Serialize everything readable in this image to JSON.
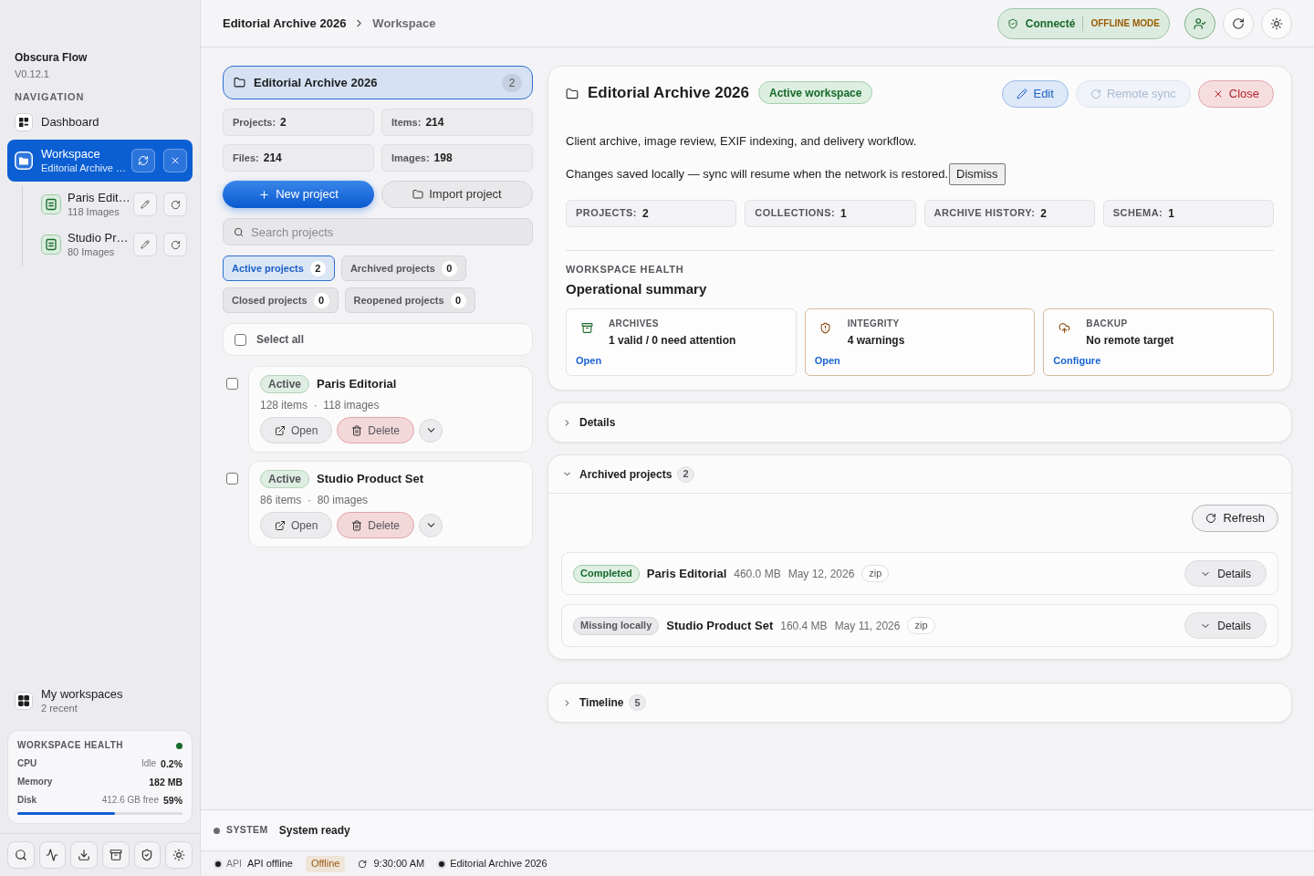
{
  "sidebar": {
    "app_name": "Obscura Flow",
    "version": "V0.12.1",
    "section_label": "NAVIGATION",
    "items": [
      {
        "kind": "link",
        "label": "Dashboard",
        "selected": false
      },
      {
        "kind": "workspace",
        "label": "Workspace",
        "sublabel": "Editorial Archive …",
        "selected": true,
        "children": [
          {
            "label": "Paris Edit…",
            "sublabel": "118 Images"
          },
          {
            "label": "Studio Pr…",
            "sublabel": "80 Images"
          }
        ]
      }
    ],
    "recent": {
      "label": "My workspaces",
      "sublabel": "2 recent"
    },
    "health": {
      "title": "WORKSPACE HEALTH",
      "healthy": true,
      "rows": [
        {
          "label": "CPU",
          "note": "Idle",
          "value": "0.2%"
        },
        {
          "label": "Memory",
          "value": "182 MB"
        },
        {
          "label": "Disk",
          "note": "412.6 GB free",
          "value": "59%",
          "level": 0.59
        }
      ]
    },
    "footer_buttons": [
      {
        "kind": "search"
      },
      {
        "kind": "activity"
      },
      {
        "kind": "download"
      },
      {
        "kind": "archive"
      },
      {
        "kind": "shield"
      },
      {
        "kind": "settings"
      }
    ]
  },
  "top_bar": {
    "breadcrumb": [
      "Editorial Archive 2026",
      "Workspace"
    ],
    "connection": {
      "label": "Connecté",
      "mode": "OFFLINE MODE"
    },
    "buttons": [
      {
        "kind": "account",
        "active": true
      },
      {
        "kind": "refresh",
        "active": false
      },
      {
        "kind": "settings",
        "active": false
      }
    ]
  },
  "workspace": {
    "title": "Editorial Archive 2026",
    "count": "2",
    "selected": true
  },
  "stats": [
    {
      "label": "Projects:",
      "value": "2"
    },
    {
      "label": "Items:",
      "value": "214"
    },
    {
      "label": "Files:",
      "value": "214"
    },
    {
      "label": "Images:",
      "value": "198"
    }
  ],
  "new_project": "New project",
  "import_project": "Import project",
  "search": {
    "placeholder": "Search projects"
  },
  "filters": [
    {
      "label": "Active projects",
      "count": "2",
      "selected": true
    },
    {
      "label": "Archived projects",
      "count": "0",
      "selected": false
    },
    {
      "label": "Closed projects",
      "count": "0",
      "selected": false
    },
    {
      "label": "Reopened projects",
      "count": "0",
      "selected": false
    }
  ],
  "select_all": {
    "label": "Select all",
    "checked": false
  },
  "projects": [
    {
      "status": "Active",
      "name": "Paris Editorial",
      "meta": "128 items  ·  118 images",
      "checked": false,
      "open": "Open",
      "delete": "Delete"
    },
    {
      "status": "Active",
      "name": "Studio Product Set",
      "meta": "86 items  ·  80 images",
      "checked": false,
      "open": "Open",
      "delete": "Delete"
    }
  ],
  "detail": {
    "title": "Editorial Archive 2026",
    "badge": "Active workspace",
    "buttons": [
      {
        "kind": "edit",
        "label": "Edit",
        "disabled": false
      },
      {
        "kind": "sync",
        "label": "Remote sync",
        "disabled": true
      },
      {
        "kind": "close",
        "label": "Close",
        "disabled": false
      }
    ],
    "description": "Client archive, image review, EXIF indexing, and delivery workflow.",
    "notice": "Changes saved locally — sync will resume when the network is restored.",
    "dismiss": "Dismiss",
    "stats": [
      {
        "label": "PROJECTS:",
        "value": "2"
      },
      {
        "label": "COLLECTIONS:",
        "value": "1"
      },
      {
        "label": "ARCHIVE HISTORY:",
        "value": "2"
      },
      {
        "label": "SCHEMA:",
        "value": "1"
      }
    ],
    "health_label": "WORKSPACE HEALTH",
    "health_title": "Operational summary",
    "health_cards": [
      {
        "kind": "archives",
        "label": "ARCHIVES",
        "value": "1 valid / 0 need attention",
        "link": "Open",
        "warning": false
      },
      {
        "kind": "integrity",
        "label": "INTEGRITY",
        "value": "4 warnings",
        "link": "Open",
        "warning": true
      },
      {
        "kind": "backup",
        "label": "BACKUP",
        "value": "No remote target",
        "link": "Configure",
        "warning": true
      }
    ]
  },
  "sections": [
    {
      "title": "Details",
      "expanded": false
    },
    {
      "title": "Archived projects",
      "count": "2",
      "expanded": true,
      "refresh": "Refresh",
      "rows": [
        {
          "kind": "completed",
          "status": "Completed",
          "name": "Paris Editorial",
          "size": "460.0 MB",
          "date": "May 12, 2026",
          "format": "zip",
          "details": "Details"
        },
        {
          "kind": "missing",
          "status": "Missing locally",
          "name": "Studio Product Set",
          "size": "160.4 MB",
          "date": "May 11, 2026",
          "format": "zip",
          "details": "Details"
        }
      ]
    },
    {
      "title": "Timeline",
      "count": "5",
      "expanded": false
    }
  ],
  "system_bar": {
    "label": "SYSTEM",
    "message": "System ready"
  },
  "status_bar": [
    {
      "kind": "api",
      "label": "API",
      "value": "API offline"
    },
    {
      "kind": "badge",
      "value": "Offline"
    },
    {
      "kind": "time",
      "value": "9:30:00 AM"
    },
    {
      "kind": "workspace",
      "value": "Editorial Archive 2026"
    }
  ]
}
